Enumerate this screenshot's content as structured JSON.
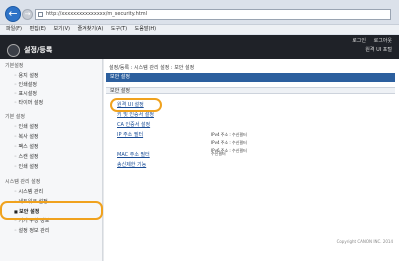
{
  "browser": {
    "back_glyph": "←",
    "forward_glyph": "→",
    "url": "http://xxxxxxxxxxxxxxx/m_security.html",
    "menu": [
      "파일(F)",
      "편집(E)",
      "보기(V)",
      "즐겨찾기(A)",
      "도구(T)",
      "도움말(H)"
    ]
  },
  "header": {
    "topbar": [
      "로그인",
      "로그아웃"
    ],
    "title": "설정/등록",
    "portal_link": "원격 UI 포털"
  },
  "sidebar": {
    "groups": [
      {
        "heading": "기본설정",
        "items": [
          "용지 설정",
          "인쇄설정",
          "표시설정",
          "타이머 설정"
        ]
      },
      {
        "heading": "기본 설정",
        "items": [
          "인쇄 설정",
          "복사 설정",
          "팩스 설정",
          "스캔 설정",
          "인쇄 설정"
        ]
      },
      {
        "heading": "시스템 관리 설정",
        "items": [
          "시스템 관리",
          "네트워크 설정"
        ]
      }
    ],
    "active_item": "보안 설정",
    "after_items": [
      "기기 구성 정보",
      "설정 정보 관리"
    ]
  },
  "main": {
    "breadcrumb": "설정/등록 : 시스템 관리 설정 : 보안 설정",
    "section_title": "보안 설정",
    "sub_title": "보안 설정",
    "links": [
      "원격 UI 설정",
      "키 및 인증서 설정",
      "CA 인증서 설정",
      "IP 주소 필터",
      "MAC 주소 필터",
      "송신제한 기능"
    ],
    "ip_filter_values": [
      "IPv4 주소 : 수신필터",
      "IPv4 주소 : 수신필터",
      "IPv6 주소 : 수신필터"
    ],
    "mac_filter_value": "수신필터",
    "footer": "Copyright CANON INC. 2014"
  }
}
